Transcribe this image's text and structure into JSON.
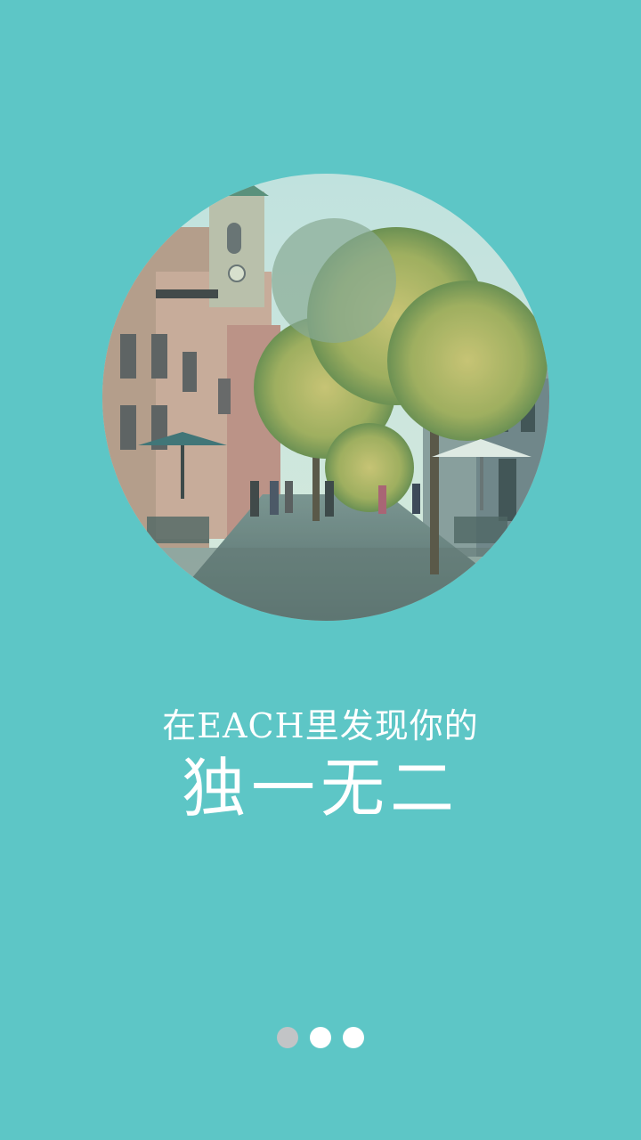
{
  "onboarding": {
    "tagline": "在EACH里发现你的",
    "headline": "独一无二",
    "image_description_icon": "street-photo",
    "page_indicator": {
      "total": 3,
      "active_index": 0
    }
  },
  "colors": {
    "background": "#5dc6c6",
    "text": "#ffffff",
    "dot_active": "#c2c4c6",
    "dot_inactive": "#ffffff"
  }
}
